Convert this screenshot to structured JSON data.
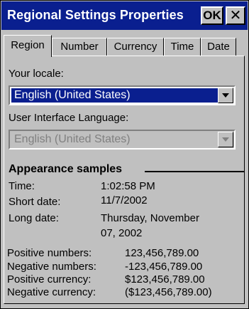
{
  "window": {
    "title": "Regional Settings Properties",
    "ok_label": "OK",
    "close_label": "✕"
  },
  "tabs": [
    {
      "label": "Region",
      "active": true
    },
    {
      "label": "Number",
      "active": false
    },
    {
      "label": "Currency",
      "active": false
    },
    {
      "label": "Time",
      "active": false
    },
    {
      "label": "Date",
      "active": false
    }
  ],
  "region": {
    "locale_label": "Your locale:",
    "locale_value": "English (United States)",
    "ui_language_label": "User Interface Language:",
    "ui_language_value": "English (United States)"
  },
  "samples": {
    "heading": "Appearance samples",
    "time_label": "Time:",
    "time_value": "1:02:58 PM",
    "short_date_label": "Short date:",
    "short_date_value": "11/7/2002",
    "long_date_label": "Long date:",
    "long_date_value_line1": "Thursday, November",
    "long_date_value_line2": "07, 2002",
    "pos_num_label": "Positive numbers:",
    "pos_num_value": "123,456,789.00",
    "neg_num_label": "Negative numbers:",
    "neg_num_value": "-123,456,789.00",
    "pos_cur_label": "Positive currency:",
    "pos_cur_value": "$123,456,789.00",
    "neg_cur_label": "Negative currency:",
    "neg_cur_value": "($123,456,789.00)"
  },
  "colors": {
    "titlebar": "#0a1f8f",
    "selection": "#0a1f8f",
    "face": "#c0c0c0"
  }
}
